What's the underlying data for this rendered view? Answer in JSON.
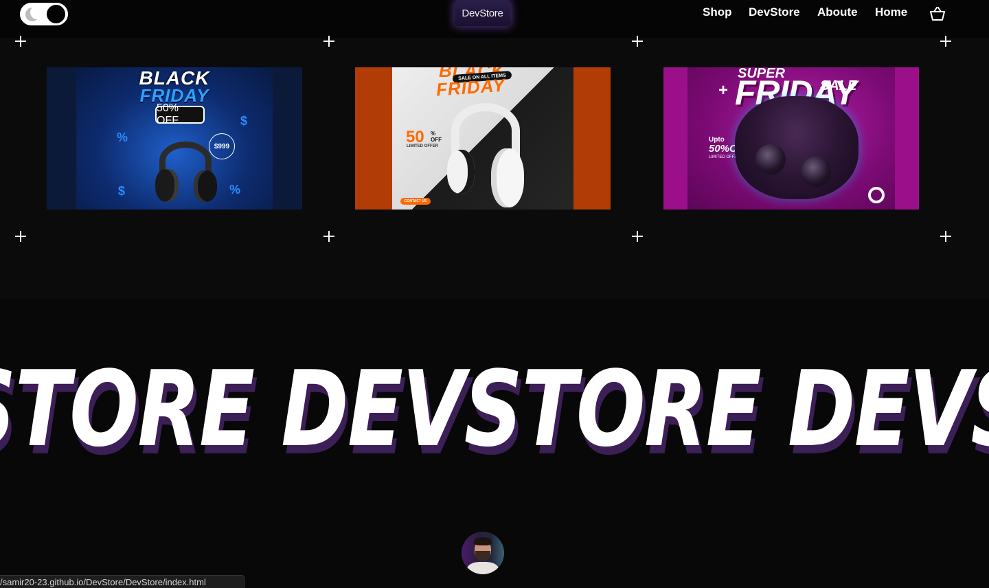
{
  "header": {
    "logo_text": "DevStore",
    "theme_toggle_icon": "moon-icon",
    "nav": [
      {
        "label": "Shop"
      },
      {
        "label": "DevStore"
      },
      {
        "label": "Aboute"
      },
      {
        "label": "Home"
      }
    ],
    "cart_icon": "basket-icon"
  },
  "products": [
    {
      "title_line1": "BLACK",
      "title_line2": "FRIDAY",
      "badge": "50% OFF",
      "price": "$999"
    },
    {
      "title_line1": "BLACK",
      "banner": "SALE ON ALL ITEMS",
      "title_line2": "FRIDAY",
      "discount": "50",
      "discount_unit": "%",
      "off": "OFF",
      "limited": "LIMITED OFFER",
      "contact": "CONTACT US"
    },
    {
      "title_line1": "SUPER",
      "title_line2": "FRIDAY",
      "tag": "SALE",
      "upto": "Upto",
      "discount": "50%OFF",
      "limited": "LIMITED OFFER"
    }
  ],
  "marquee": {
    "text": "STORE DEVSTORE DEVSTORE D"
  },
  "status_url": "/samir20-23.github.io/DevStore/DevStore/index.html"
}
